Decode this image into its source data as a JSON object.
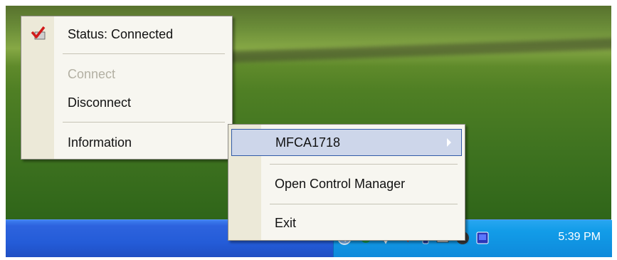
{
  "menu1": {
    "status": "Status: Connected",
    "connect": "Connect",
    "disconnect": "Disconnect",
    "information": "Information"
  },
  "menu2": {
    "device": "MFCA1718",
    "open_control_manager": "Open Control Manager",
    "exit": "Exit"
  },
  "tray": {
    "clock": "5:39 PM",
    "icons": [
      "network-icon",
      "antivirus-icon",
      "volume-icon",
      "mobile-icon",
      "printer-icon",
      "globe-icon",
      "app-icon"
    ]
  },
  "colors": {
    "menu_bg": "#f7f6f0",
    "gutter": "#ece9d8",
    "highlight": "#cdd6ea",
    "taskbar": "#245cd8",
    "tray": "#129ce8"
  }
}
